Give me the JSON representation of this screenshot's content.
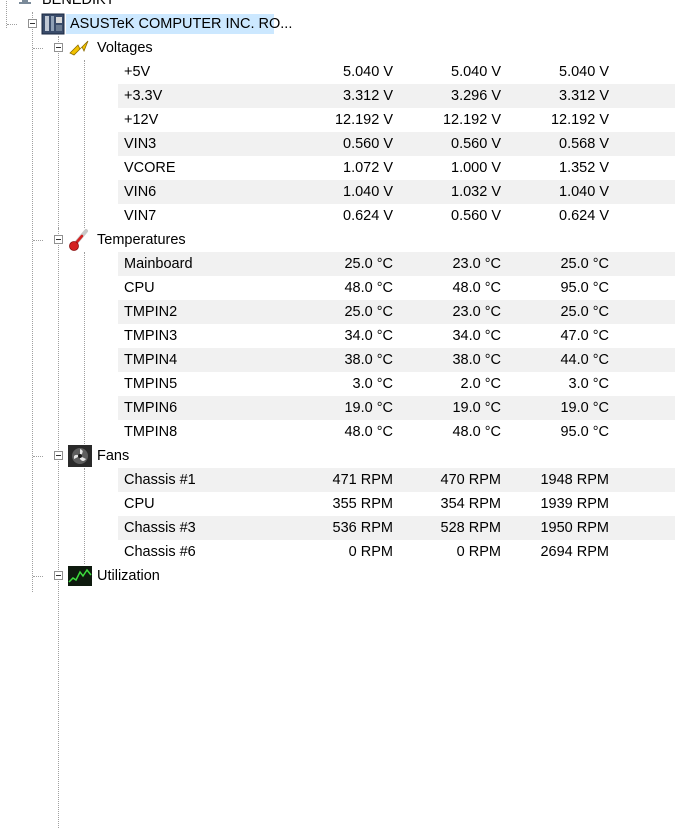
{
  "computer": {
    "name": "BENEDIKT"
  },
  "board": {
    "name": "ASUSTeK COMPUTER INC. RO..."
  },
  "groups": {
    "voltages": {
      "label": "Voltages",
      "rows": [
        {
          "name": "+5V",
          "value": "5.040 V",
          "min": "5.040 V",
          "max": "5.040 V"
        },
        {
          "name": "+3.3V",
          "value": "3.312 V",
          "min": "3.296 V",
          "max": "3.312 V"
        },
        {
          "name": "+12V",
          "value": "12.192 V",
          "min": "12.192 V",
          "max": "12.192 V"
        },
        {
          "name": "VIN3",
          "value": "0.560 V",
          "min": "0.560 V",
          "max": "0.568 V"
        },
        {
          "name": "VCORE",
          "value": "1.072 V",
          "min": "1.000 V",
          "max": "1.352 V"
        },
        {
          "name": "VIN6",
          "value": "1.040 V",
          "min": "1.032 V",
          "max": "1.040 V"
        },
        {
          "name": "VIN7",
          "value": "0.624 V",
          "min": "0.560 V",
          "max": "0.624 V"
        }
      ]
    },
    "temperatures": {
      "label": "Temperatures",
      "rows": [
        {
          "name": "Mainboard",
          "value": "25.0 °C",
          "min": "23.0 °C",
          "max": "25.0 °C"
        },
        {
          "name": "CPU",
          "value": "48.0 °C",
          "min": "48.0 °C",
          "max": "95.0 °C"
        },
        {
          "name": "TMPIN2",
          "value": "25.0 °C",
          "min": "23.0 °C",
          "max": "25.0 °C"
        },
        {
          "name": "TMPIN3",
          "value": "34.0 °C",
          "min": "34.0 °C",
          "max": "47.0 °C"
        },
        {
          "name": "TMPIN4",
          "value": "38.0 °C",
          "min": "38.0 °C",
          "max": "44.0 °C"
        },
        {
          "name": "TMPIN5",
          "value": "3.0 °C",
          "min": "2.0 °C",
          "max": "3.0 °C"
        },
        {
          "name": "TMPIN6",
          "value": "19.0 °C",
          "min": "19.0 °C",
          "max": "19.0 °C"
        },
        {
          "name": "TMPIN8",
          "value": "48.0 °C",
          "min": "48.0 °C",
          "max": "95.0 °C"
        }
      ]
    },
    "fans": {
      "label": "Fans",
      "rows": [
        {
          "name": "Chassis #1",
          "value": "471 RPM",
          "min": "470 RPM",
          "max": "1948 RPM"
        },
        {
          "name": "CPU",
          "value": "355 RPM",
          "min": "354 RPM",
          "max": "1939 RPM"
        },
        {
          "name": "Chassis #3",
          "value": "536 RPM",
          "min": "528 RPM",
          "max": "1950 RPM"
        },
        {
          "name": "Chassis #6",
          "value": "0 RPM",
          "min": "0 RPM",
          "max": "2694 RPM"
        }
      ]
    },
    "utilization": {
      "label": "Utilization"
    }
  },
  "colors": {
    "selection": "#cce8ff",
    "alt_row": "#f1f1f1",
    "tree_line": "#a0a0a0"
  },
  "icons": {
    "computer": "monitor-icon",
    "board": "motherboard-icon",
    "voltages": "lightning-icon",
    "temperatures": "thermometer-icon",
    "fans": "fan-icon",
    "utilization": "chart-icon"
  }
}
